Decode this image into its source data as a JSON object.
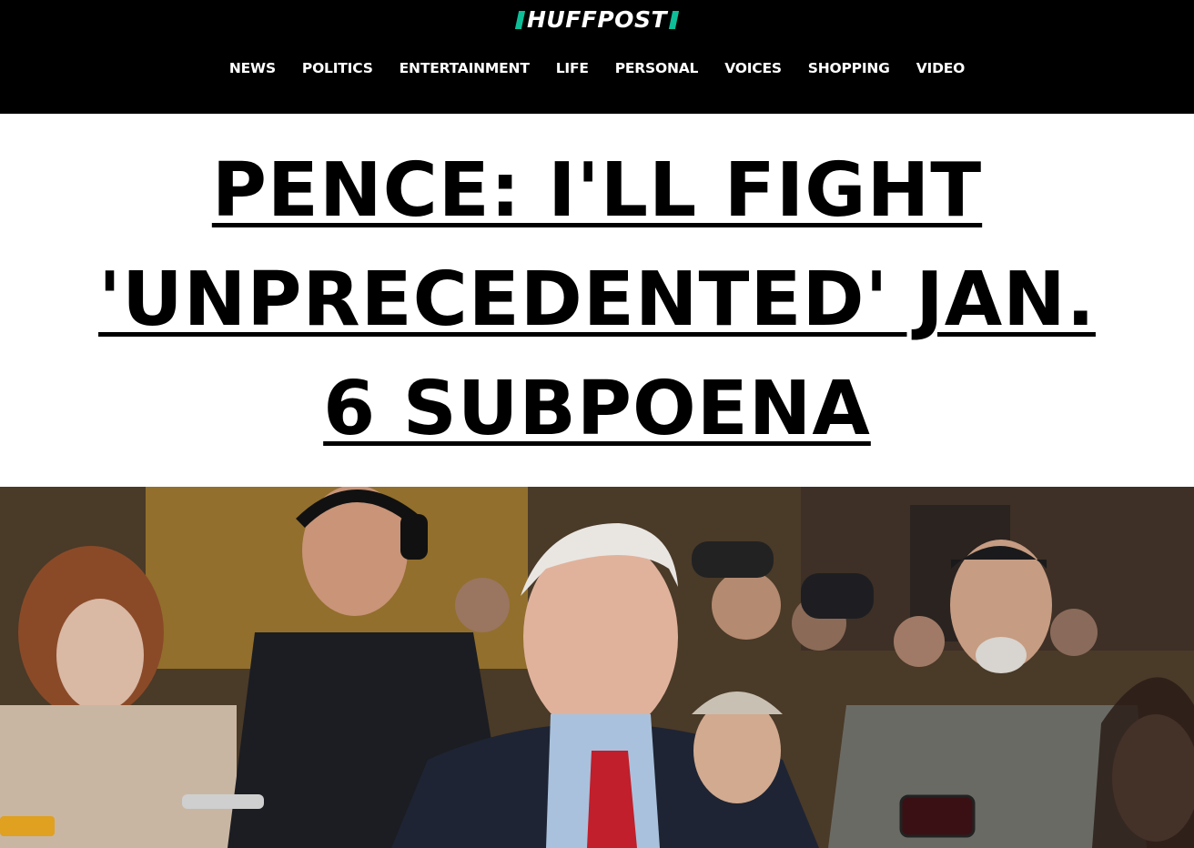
{
  "brand": {
    "logo_text": "HUFFPOST",
    "accent_color": "#0dbe98"
  },
  "nav": {
    "items": [
      {
        "label": "NEWS"
      },
      {
        "label": "POLITICS"
      },
      {
        "label": "ENTERTAINMENT"
      },
      {
        "label": "LIFE"
      },
      {
        "label": "PERSONAL"
      },
      {
        "label": "VOICES"
      },
      {
        "label": "SHOPPING"
      },
      {
        "label": "VIDEO"
      }
    ]
  },
  "article": {
    "headline": "PENCE: I'LL FIGHT 'UNPRECEDENTED' JAN. 6 SUBPOENA"
  },
  "hero_image": {
    "icon": "news-photo"
  }
}
